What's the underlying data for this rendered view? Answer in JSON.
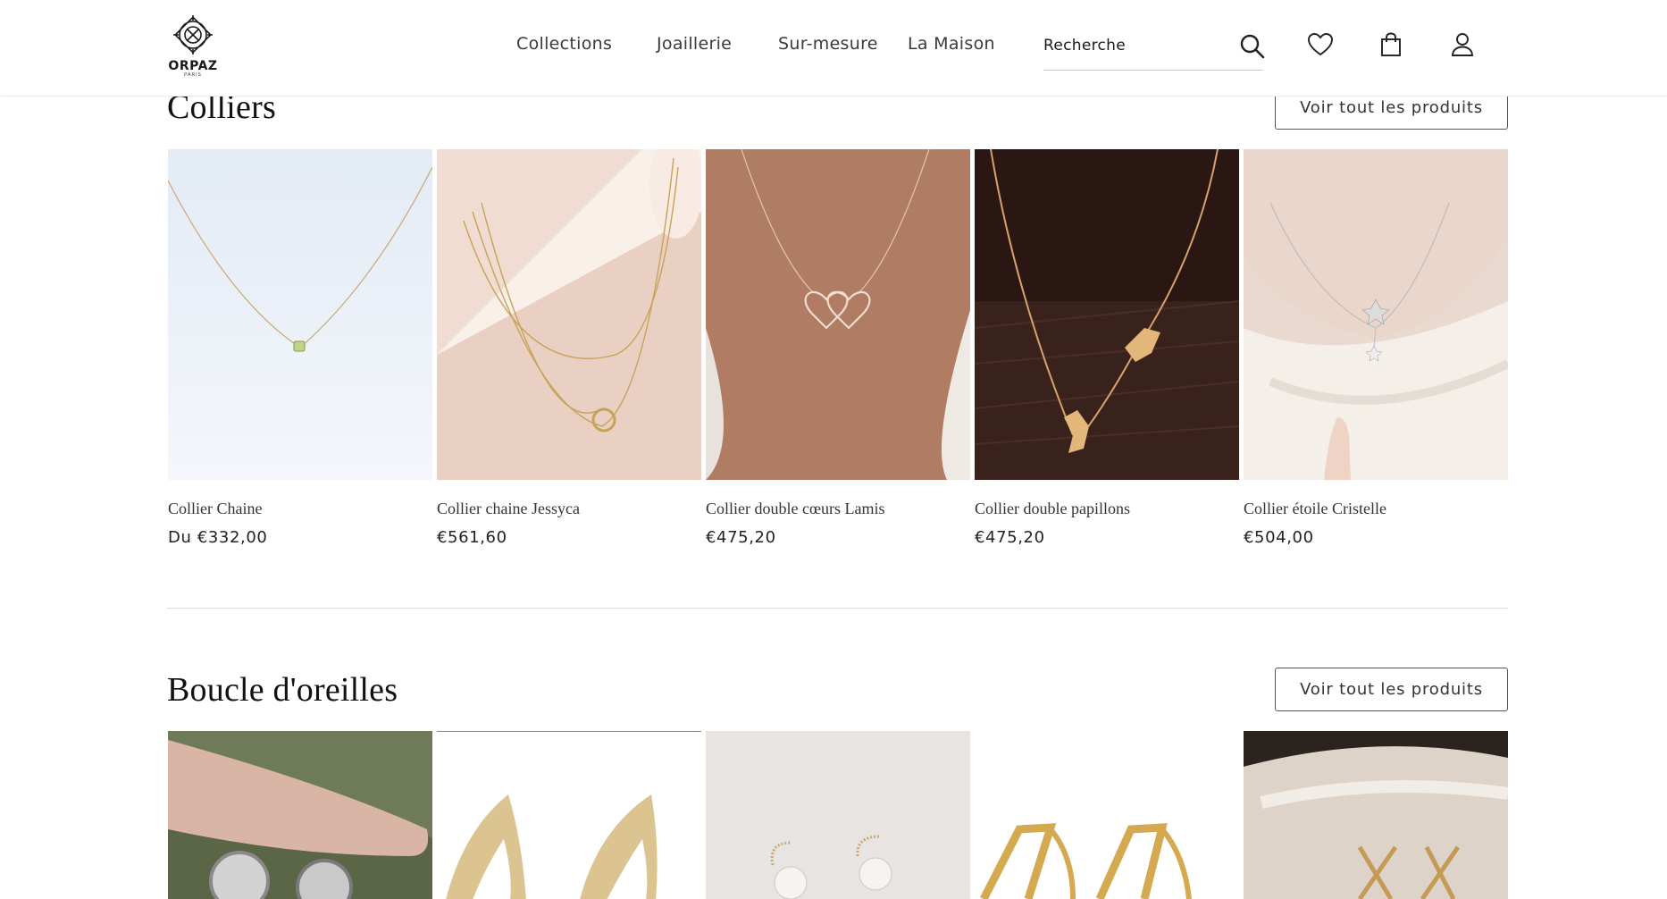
{
  "brand": {
    "name": "ORPAZ",
    "sub": "PARIS"
  },
  "nav": {
    "items": [
      {
        "label": "Collections"
      },
      {
        "label": "Joaillerie"
      },
      {
        "label": "Sur-mesure"
      },
      {
        "label": "La Maison"
      }
    ],
    "search_placeholder": "Recherche"
  },
  "icons": [
    "search-icon",
    "heart-icon",
    "bag-icon",
    "user-icon"
  ],
  "colliers": {
    "title": "Colliers",
    "view_all": "Voir tout les produits",
    "products": [
      {
        "name": "Collier Chaine",
        "price": "Du €332,00"
      },
      {
        "name": "Collier chaine Jessyca",
        "price": "€561,60"
      },
      {
        "name": "Collier double cœurs Lamis",
        "price": "€475,20"
      },
      {
        "name": "Collier double papillons",
        "price": "€475,20"
      },
      {
        "name": "Collier étoile Cristelle",
        "price": "€504,00"
      }
    ]
  },
  "boucles": {
    "title": "Boucle d'oreilles",
    "view_all": "Voir tout les produits"
  },
  "colors": {
    "text": "#1a1a1a",
    "border": "#555555",
    "divider": "#dcdcdc"
  }
}
